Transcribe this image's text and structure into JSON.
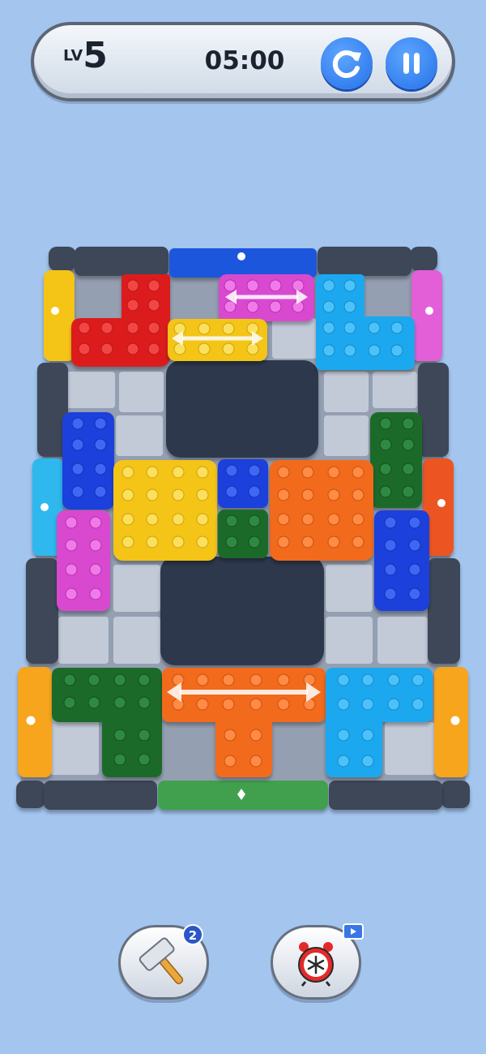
{
  "header": {
    "level_prefix": "LV",
    "level_number": "5",
    "timer": "05:00",
    "restart_icon": "restart-icon",
    "pause_icon": "pause-icon"
  },
  "colors": {
    "background": "#a3c5ee",
    "button_blue": "#2f7cf0",
    "frame_dark": "#3d4659"
  },
  "board": {
    "pieces": [
      "red",
      "magenta",
      "cyan",
      "yellow",
      "blue",
      "green",
      "yellow",
      "blue",
      "orange",
      "magenta",
      "green",
      "blue",
      "green",
      "orange",
      "cyan"
    ],
    "gates": [
      "blue",
      "yellow",
      "magenta",
      "cyan",
      "orange",
      "orange",
      "orange",
      "green"
    ]
  },
  "tools": {
    "hammer": {
      "icon": "hammer-icon",
      "count": "2"
    },
    "freeze": {
      "icon": "freeze-clock-icon",
      "ad_icon": "video-ad-icon"
    }
  }
}
